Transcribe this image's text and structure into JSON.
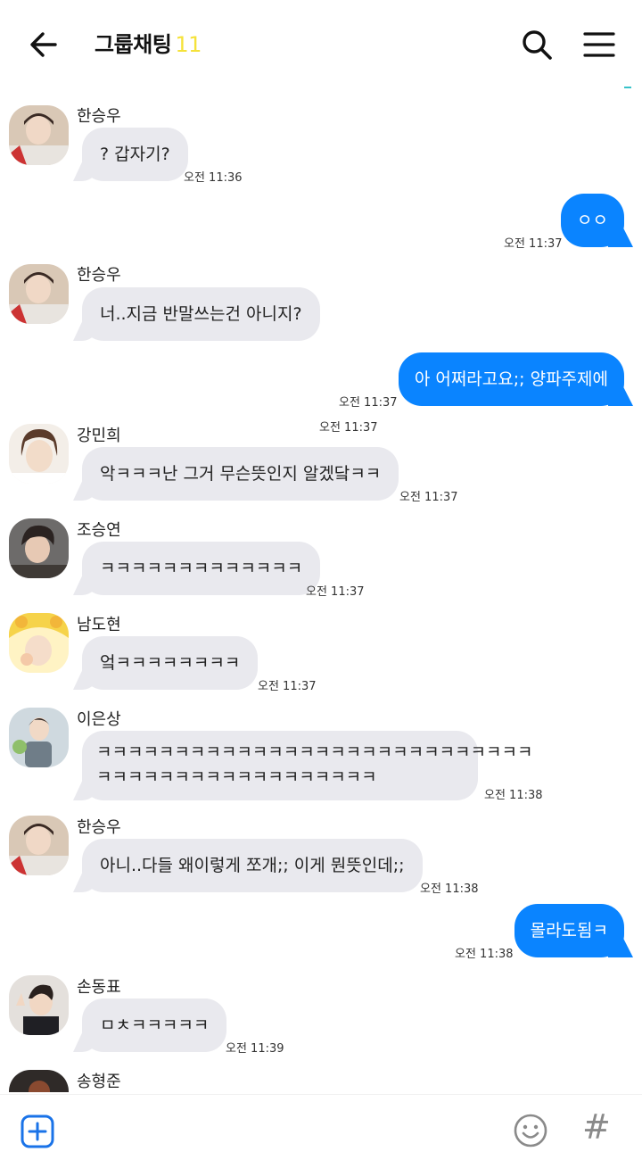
{
  "header": {
    "title": "그룹채팅",
    "member_count": "11",
    "back_icon": "arrow-left-icon",
    "search_icon": "search-icon",
    "menu_icon": "hamburger-menu-icon"
  },
  "messages": [
    {
      "type": "in",
      "sender": "한승우",
      "text": "? 갑자기?",
      "time": "오전 11:36"
    },
    {
      "type": "out",
      "text": "ㅇㅇ",
      "time": "오전 11:37"
    },
    {
      "type": "in",
      "sender": "한승우",
      "text": "너..지금 반말쓰는건 아니지?",
      "time": "오전 11:37"
    },
    {
      "type": "out",
      "text": "아 어쩌라고요;; 양파주제에",
      "time": "오전 11:37"
    },
    {
      "type": "in",
      "sender": "강민희",
      "text": "악ㅋㅋㅋ난 그거 무슨뜻인지 알겠닼ㅋㅋ",
      "time": "오전 11:37"
    },
    {
      "type": "in",
      "sender": "조승연",
      "text": "ㅋㅋㅋㅋㅋㅋㅋㅋㅋㅋㅋㅋㅋ",
      "time": "오전 11:37"
    },
    {
      "type": "in",
      "sender": "남도현",
      "text": "엌ㅋㅋㅋㅋㅋㅋㅋㅋ",
      "time": "오전 11:37"
    },
    {
      "type": "in",
      "sender": "이은상",
      "text_line1": "ㅋㅋㅋㅋㅋㅋㅋㅋㅋㅋㅋㅋㅋㅋㅋㅋㅋㅋㅋㅋㅋㅋㅋㅋㅋㅋㅋㅋ",
      "text_line2": "ㅋㅋㅋㅋㅋㅋㅋㅋㅋㅋㅋㅋㅋㅋㅋㅋㅋㅋ",
      "time": "오전 11:38"
    },
    {
      "type": "in",
      "sender": "한승우",
      "text": "아니..다들 왜이렇게 쪼개;; 이게 뭔뜻인데;;",
      "time": "오전 11:38"
    },
    {
      "type": "out",
      "text": "몰라도됨ㅋ",
      "time": "오전 11:38"
    },
    {
      "type": "in",
      "sender": "손동표",
      "text": "ㅁㅊㅋㅋㅋㅋㅋ",
      "time": "오전 11:39"
    },
    {
      "type": "in",
      "sender": "송형준",
      "text": "",
      "time": ""
    }
  ],
  "input_bar": {
    "plus_icon": "plus-square-icon",
    "emoji_icon": "smiley-icon",
    "hash_label": "#"
  },
  "colors": {
    "outgoing_bubble": "#0a84ff",
    "incoming_bubble": "#e9e9ee",
    "member_count": "#f5e23a"
  }
}
